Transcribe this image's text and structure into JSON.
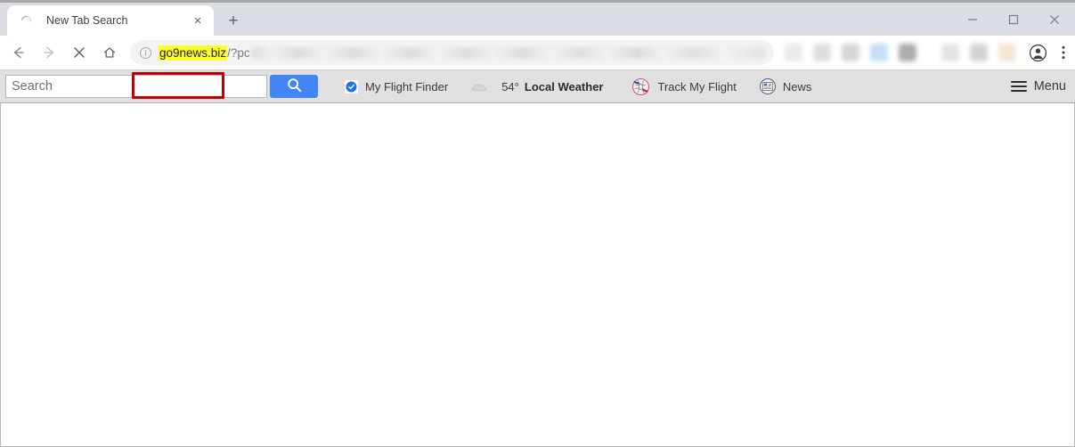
{
  "window": {
    "controls": [
      {
        "name": "minimize",
        "glyph": "minimize-icon"
      },
      {
        "name": "maximize",
        "glyph": "maximize-icon"
      },
      {
        "name": "close",
        "glyph": "close-icon"
      }
    ]
  },
  "tab_strip": {
    "tabs": [
      {
        "title": "New Tab Search",
        "favicon": "loading-spinner-icon",
        "close_label": "×"
      }
    ],
    "new_tab_label": "+"
  },
  "nav_bar": {
    "back_icon": "back-arrow-icon",
    "forward_icon": "forward-arrow-icon",
    "stop_icon": "stop-x-icon",
    "home_icon": "home-icon",
    "site_info_icon": "info-circle-icon",
    "url": {
      "domain": "go9news.biz",
      "path": "/?pc",
      "full_display": "go9news.biz/?pc"
    },
    "profile_icon": "profile-avatar-icon",
    "menu_icon": "three-dot-menu-icon"
  },
  "annotation": {
    "type": "red-highlight-box",
    "color": "#c00000",
    "target": "go9news.biz",
    "highlight_color": "#fdfd28"
  },
  "hijack_toolbar": {
    "search": {
      "placeholder": "Search",
      "value": "",
      "button_icon": "search-magnifier-icon",
      "button_color": "#4285f4"
    },
    "items": [
      {
        "label": "My Flight Finder",
        "icon": "blue-check-badge-icon",
        "bold": false
      },
      {
        "label": "Local Weather",
        "icon": "cloud-icon",
        "bold": true,
        "temperature": "54°"
      },
      {
        "label": "Track My Flight",
        "icon": "globe-airplane-icon",
        "bold": false
      },
      {
        "label": "News",
        "icon": "newspaper-circle-icon",
        "bold": false
      }
    ],
    "menu": {
      "label": "Menu",
      "icon": "hamburger-menu-icon"
    }
  },
  "page": {
    "content": ""
  }
}
